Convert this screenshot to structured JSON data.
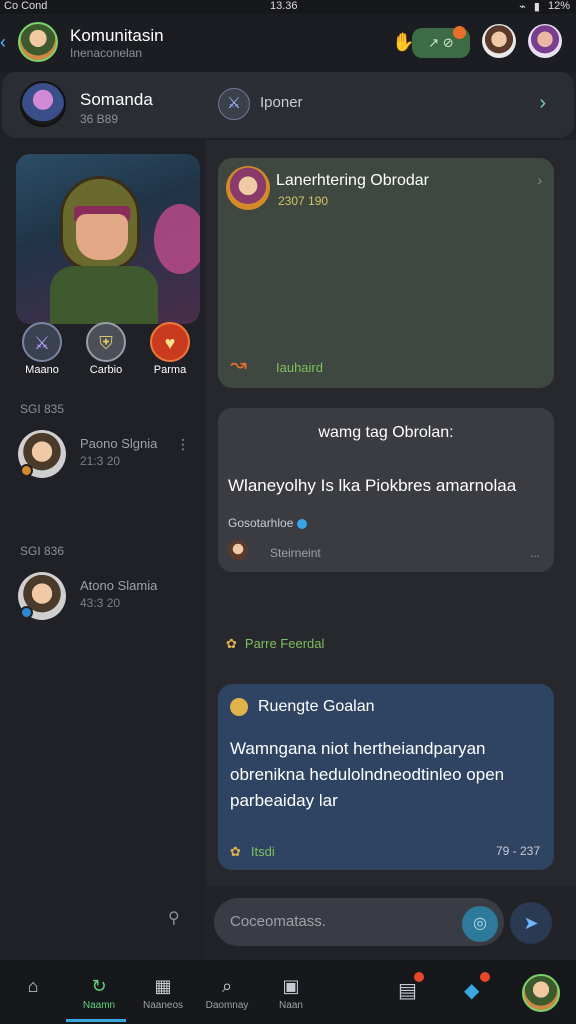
{
  "statusbar": {
    "left": "Co Cond",
    "time": "13.36",
    "battery": "12%"
  },
  "header": {
    "title": "Komunitasin",
    "subtitle": "Inenaconelan",
    "pill_label": "↗ ⊘"
  },
  "group": {
    "name": "Somanda",
    "meta": "36 B89",
    "action_label": "Iponer"
  },
  "roles": [
    {
      "label": "Maano"
    },
    {
      "label": "Carbio"
    },
    {
      "label": "Parma"
    }
  ],
  "members": [
    {
      "section": "SGI 835",
      "name": "Paono Slgnia",
      "time": "21:3 20"
    },
    {
      "section": "SGI 836",
      "name": "Atono Slamia",
      "time": "43:3 20"
    }
  ],
  "posts": {
    "p1": {
      "title": "Lanerhtering Obrodar",
      "meta": "2307 190",
      "reaction_label": "Iauhaird"
    },
    "p2": {
      "title": "wamg tag Obrolan:",
      "body": "Wlaneyolhy Is lka Piokbres amarnolaa",
      "tag": "Gosotarhloe",
      "footer": "Steirneint",
      "more": "..."
    },
    "reaction_row": "Parre Feerdal",
    "p3": {
      "title": "Ruengte Goalan",
      "body": "Wamngana niot hertheiandparyan obrenikna hedulolndneodtinleo open parbeaiday lar",
      "footer": "Itsdi",
      "stamp": "79 - 237"
    }
  },
  "composer": {
    "placeholder": "Coceomatass."
  },
  "tabs": [
    {
      "label": ""
    },
    {
      "label": "Naamn"
    },
    {
      "label": "Naaneos"
    },
    {
      "label": "Daomnay"
    },
    {
      "label": "Naan"
    }
  ],
  "colors": {
    "accent": "#5fd47a",
    "link": "#39a7e0",
    "post_blue": "#2f4462",
    "post_green": "#3e4740"
  }
}
